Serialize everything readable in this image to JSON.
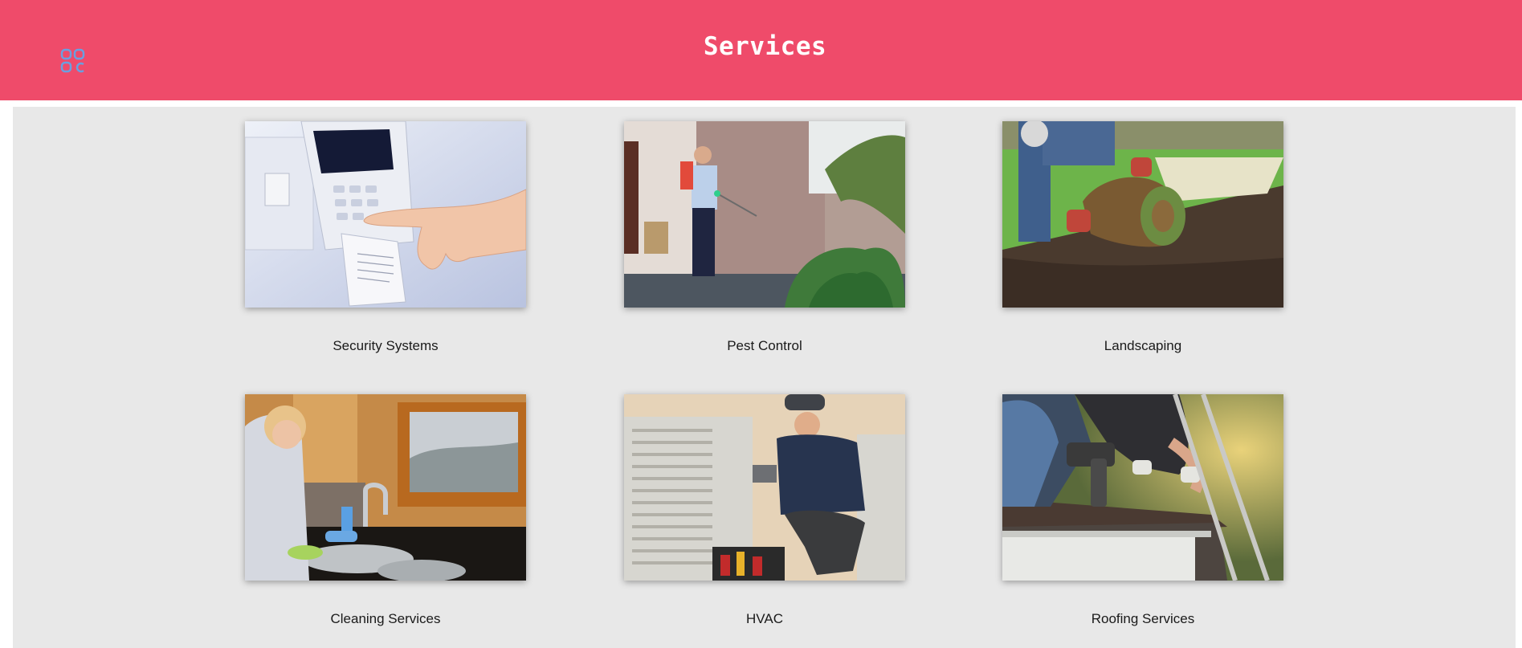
{
  "header": {
    "title": "Services",
    "menu_icon": "grid-icon",
    "background_color": "#ef4b6a"
  },
  "services": [
    {
      "label": "Security Systems",
      "image": "security-keypad-photo"
    },
    {
      "label": "Pest Control",
      "image": "pest-control-photo"
    },
    {
      "label": "Landscaping",
      "image": "landscaping-sod-photo"
    },
    {
      "label": "Cleaning Services",
      "image": "cleaning-sink-photo"
    },
    {
      "label": "HVAC",
      "image": "hvac-technician-photo"
    },
    {
      "label": "Roofing Services",
      "image": "roofing-nailer-photo"
    }
  ]
}
